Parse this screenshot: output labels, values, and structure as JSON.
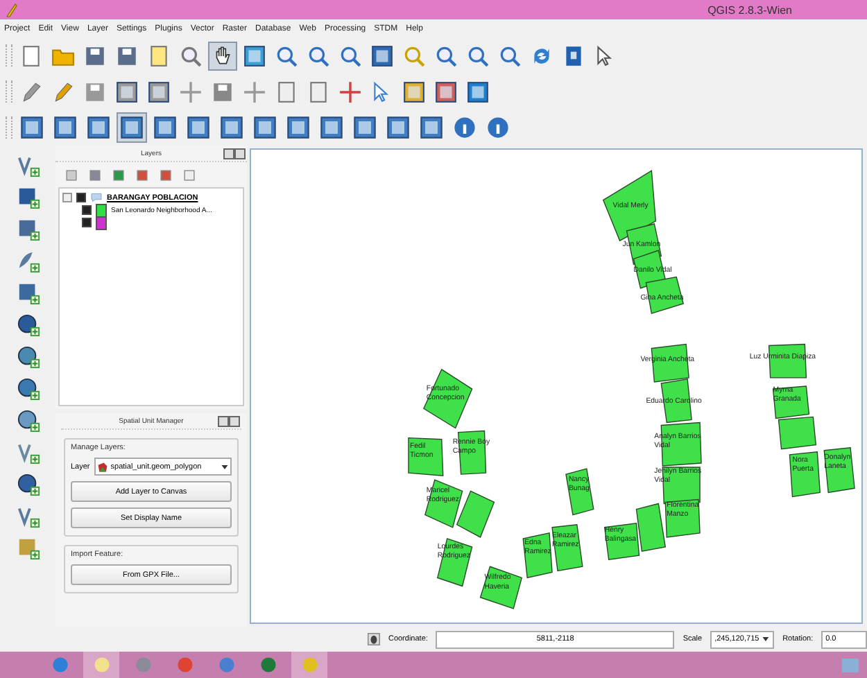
{
  "window": {
    "title": "QGIS 2.8.3-Wien"
  },
  "menu": [
    "Project",
    "Edit",
    "View",
    "Layer",
    "Settings",
    "Plugins",
    "Vector",
    "Raster",
    "Database",
    "Web",
    "Processing",
    "STDM",
    "Help"
  ],
  "layers_panel": {
    "title": "Layers",
    "tree": [
      {
        "label": "BARANGAY POBLACION",
        "checked": true,
        "expanded": true,
        "children": [
          {
            "label": "San Leonardo Neighborhood A...",
            "color": "#33dd44",
            "checked": true
          },
          {
            "color": "#cc33cc",
            "checked": true
          }
        ]
      }
    ]
  },
  "spatial_unit_manager": {
    "title": "Spatial Unit Manager",
    "manage_group": "Manage Layers:",
    "layer_label": "Layer",
    "layer_value": "spatial_unit.geom_polygon",
    "buttons": [
      "Add Layer to Canvas",
      "Set Display Name"
    ],
    "import_group": "Import Feature:",
    "import_button": "From GPX File..."
  },
  "map": {
    "parcels": [
      {
        "kind": "labeled",
        "label": [
          "Vidal Merly"
        ]
      },
      {
        "kind": "labeled",
        "label": [
          "Jun Kamlon"
        ]
      },
      {
        "kind": "labeled",
        "label": [
          "Danilo Vidal"
        ]
      },
      {
        "kind": "labeled",
        "label": [
          "Gina Ancheta"
        ]
      },
      {
        "kind": "labeled",
        "label": [
          "Verginia Ancheta"
        ]
      },
      {
        "kind": "labeled",
        "label": [
          "Eduardo Carolino"
        ]
      },
      {
        "kind": "labeled",
        "label": [
          "Analyn Barrios",
          "Vidal"
        ]
      },
      {
        "kind": "labeled",
        "label": [
          "Jenilyn Barrios",
          "Vidal"
        ]
      },
      {
        "kind": "labeled",
        "label": [
          "Florentina",
          "Manzo"
        ]
      },
      {
        "kind": "unlabeled"
      },
      {
        "kind": "labeled",
        "label": [
          "Henry",
          "Balingasa"
        ]
      },
      {
        "kind": "labeled",
        "label": [
          "Luz Urminita Diapiza"
        ]
      },
      {
        "kind": "labeled",
        "label": [
          "Myrna",
          "Granada"
        ]
      },
      {
        "kind": "unlabeled"
      },
      {
        "kind": "labeled",
        "label": [
          "Nora",
          "Puerta"
        ]
      },
      {
        "kind": "labeled",
        "label": [
          "Donalyn",
          "Laneta"
        ]
      },
      {
        "kind": "labeled",
        "label": [
          "Fortunado",
          "Concepcion"
        ]
      },
      {
        "kind": "labeled",
        "label": [
          "Fedil",
          "Ticmon"
        ]
      },
      {
        "kind": "labeled",
        "label": [
          "Rennie Boy",
          "Campo"
        ]
      },
      {
        "kind": "labeled",
        "label": [
          "Maricel",
          "Rodriguez"
        ]
      },
      {
        "kind": "unlabeled"
      },
      {
        "kind": "labeled",
        "label": [
          "Lourdes",
          "Rodriguez"
        ]
      },
      {
        "kind": "labeled",
        "label": [
          "Wilfredo",
          "Haveria"
        ]
      },
      {
        "kind": "labeled",
        "label": [
          "Edna",
          "Ramirez"
        ]
      },
      {
        "kind": "labeled",
        "label": [
          "Eleazar",
          "Ramirez"
        ]
      },
      {
        "kind": "labeled",
        "label": [
          "Nancy",
          "Bunag"
        ]
      }
    ]
  },
  "status_bar": {
    "coordinate_label": "Coordinate:",
    "coordinate": "5811,-2118",
    "scale_label": "Scale",
    "scale": ",245,120,715",
    "rotation_label": "Rotation:",
    "rotation": "0.0"
  },
  "taskbar": {
    "apps": [
      {
        "selected": false
      },
      {
        "selected": true
      },
      {
        "selected": false
      },
      {
        "selected": false
      },
      {
        "selected": false
      },
      {
        "selected": false
      },
      {
        "selected": true
      }
    ]
  }
}
